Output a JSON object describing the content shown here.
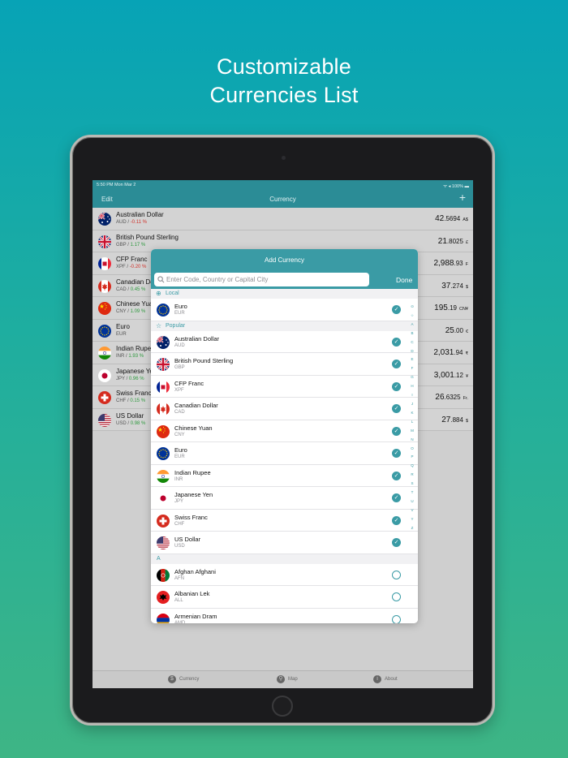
{
  "headline": {
    "line1": "Customizable",
    "line2": "Currencies List"
  },
  "status_bar": {
    "time": "5:50 PM  Mon Mar 2",
    "right": "ᯤ ◂ 100% ▬"
  },
  "nav": {
    "edit": "Edit",
    "title": "Currency",
    "add": "+"
  },
  "currency_list": [
    {
      "name": "Australian Dollar",
      "code": "AUD",
      "change": "-0.11 %",
      "trend": "neg",
      "int": "42",
      "dec": ".5694",
      "sym": "A$",
      "flag": "aud"
    },
    {
      "name": "British Pound Sterling",
      "code": "GBP",
      "change": "1.17 %",
      "trend": "pos",
      "int": "21",
      "dec": ".8025",
      "sym": "£",
      "flag": "gbp"
    },
    {
      "name": "CFP Franc",
      "code": "XPF",
      "change": "-0.20 %",
      "trend": "neg",
      "int": "2,988",
      "dec": ".93",
      "sym": "F",
      "flag": "xpf"
    },
    {
      "name": "Canadian Do",
      "code": "CAD",
      "change": "0.45 %",
      "trend": "pos",
      "int": "37",
      "dec": ".274",
      "sym": "$",
      "flag": "cad"
    },
    {
      "name": "Chinese Yua",
      "code": "CNY",
      "change": "1.09 %",
      "trend": "pos",
      "int": "195",
      "dec": ".19",
      "sym": "CN¥",
      "flag": "cny"
    },
    {
      "name": "Euro",
      "code": "EUR",
      "change": "",
      "trend": "pos",
      "int": "25",
      "dec": ".00",
      "sym": "€",
      "flag": "eur"
    },
    {
      "name": "Indian Rupe",
      "code": "INR",
      "change": "1.93 %",
      "trend": "pos",
      "int": "2,031",
      "dec": ".94",
      "sym": "₹",
      "flag": "inr"
    },
    {
      "name": "Japanese Ye",
      "code": "JPY",
      "change": "0.96 %",
      "trend": "pos",
      "int": "3,001",
      "dec": ".12",
      "sym": "¥",
      "flag": "jpy"
    },
    {
      "name": "Swiss Franc",
      "code": "CHF",
      "change": "0.15 %",
      "trend": "pos",
      "int": "26",
      "dec": ".6325",
      "sym": "Fr.",
      "flag": "chf"
    },
    {
      "name": "US Dollar",
      "code": "USD",
      "change": "0.98 %",
      "trend": "pos",
      "int": "27",
      "dec": ".884",
      "sym": "$",
      "flag": "usd"
    }
  ],
  "tabs": [
    {
      "label": "Currency",
      "icon": "$",
      "icon_name": "currency-tab-icon"
    },
    {
      "label": "Map",
      "icon": "⚲",
      "icon_name": "map-pin-icon"
    },
    {
      "label": "About",
      "icon": "i",
      "icon_name": "info-icon"
    }
  ],
  "modal": {
    "title": "Add Currency",
    "search_placeholder": "Enter Code, Country or Capital City",
    "done": "Done",
    "sections": [
      {
        "title": "Local",
        "icon": "⊕",
        "items": [
          {
            "name": "Euro",
            "code": "EUR",
            "flag": "eur",
            "selected": true
          }
        ]
      },
      {
        "title": "Popular",
        "icon": "☆",
        "items": [
          {
            "name": "Australian Dollar",
            "code": "AUD",
            "flag": "aud",
            "selected": true
          },
          {
            "name": "British Pound Sterling",
            "code": "GBP",
            "flag": "gbp",
            "selected": true
          },
          {
            "name": "CFP Franc",
            "code": "XPF",
            "flag": "xpf",
            "selected": true
          },
          {
            "name": "Canadian Dollar",
            "code": "CAD",
            "flag": "cad",
            "selected": true
          },
          {
            "name": "Chinese Yuan",
            "code": "CNY",
            "flag": "cny",
            "selected": true
          },
          {
            "name": "Euro",
            "code": "EUR",
            "flag": "eur",
            "selected": true
          },
          {
            "name": "Indian Rupee",
            "code": "INR",
            "flag": "inr",
            "selected": true
          },
          {
            "name": "Japanese Yen",
            "code": "JPY",
            "flag": "jpy",
            "selected": true
          },
          {
            "name": "Swiss Franc",
            "code": "CHF",
            "flag": "chf",
            "selected": true
          },
          {
            "name": "US Dollar",
            "code": "USD",
            "flag": "usd",
            "selected": true
          }
        ]
      },
      {
        "title": "A",
        "icon": "",
        "items": [
          {
            "name": "Afghan Afghani",
            "code": "AFN",
            "flag": "afn",
            "selected": false
          },
          {
            "name": "Albanian Lek",
            "code": "ALL",
            "flag": "all",
            "selected": false
          },
          {
            "name": "Armenian Dram",
            "code": "AMD",
            "flag": "amd",
            "selected": false
          }
        ]
      }
    ],
    "index_letters": [
      "⊙",
      "☆",
      "A",
      "B",
      "C",
      "D",
      "E",
      "F",
      "G",
      "H",
      "I",
      "J",
      "K",
      "L",
      "M",
      "N",
      "O",
      "P",
      "Q",
      "R",
      "S",
      "T",
      "U",
      "V",
      "Y",
      "Z"
    ]
  },
  "colors": {
    "accent": "#3a9ba5",
    "nav": "#2b8c96",
    "negative": "#d0332b",
    "positive": "#2f9a3f"
  }
}
